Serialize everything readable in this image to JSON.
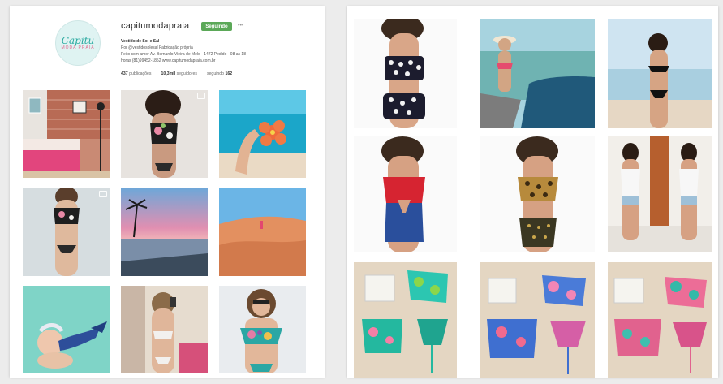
{
  "profile": {
    "logo_text": "Capitu",
    "logo_sub": "MODA PRAIA",
    "username": "capitumodapraia",
    "follow_label": "Seguindo",
    "more_label": "•••",
    "bio_name": "Vestido de Sol e Sal",
    "bio_lines": [
      "Por @vestidosolesal  Fabricação própria",
      "Feito com amor  Av. Bernardo Vieira de Melo - 1472  Pedido - 08 as 18",
      "horas  (81)99452-1852  www.capitumodapraia.com.br"
    ],
    "stats": {
      "posts_value": "437",
      "posts_label": "publicações",
      "followers_value": "10,3mil",
      "followers_label": "seguidores",
      "following_label": "seguindo",
      "following_value": "162"
    }
  },
  "left_grid": [
    {
      "name": "interior-room-photo",
      "video": false
    },
    {
      "name": "floral-top-photo",
      "video": true
    },
    {
      "name": "hand-flower-beach-photo",
      "video": false
    },
    {
      "name": "model-floral-bikini-photo",
      "video": true
    },
    {
      "name": "sunset-sea-photo",
      "video": false
    },
    {
      "name": "dunes-photo",
      "video": false
    },
    {
      "name": "baby-mermaid-photo",
      "video": false
    },
    {
      "name": "mirror-selfie-photo",
      "video": false
    },
    {
      "name": "floral-offshoulder-photo",
      "video": false
    }
  ],
  "right_grid": [
    {
      "name": "polka-dot-bikini-photo"
    },
    {
      "name": "boat-model-photo"
    },
    {
      "name": "beach-black-bikini-photo"
    },
    {
      "name": "red-blue-swimsuit-photo"
    },
    {
      "name": "leopard-halter-photo"
    },
    {
      "name": "two-models-white-photo"
    },
    {
      "name": "tropical-set-flatlay-1-photo"
    },
    {
      "name": "tropical-set-flatlay-2-photo"
    },
    {
      "name": "tropical-set-flatlay-3-photo"
    }
  ]
}
